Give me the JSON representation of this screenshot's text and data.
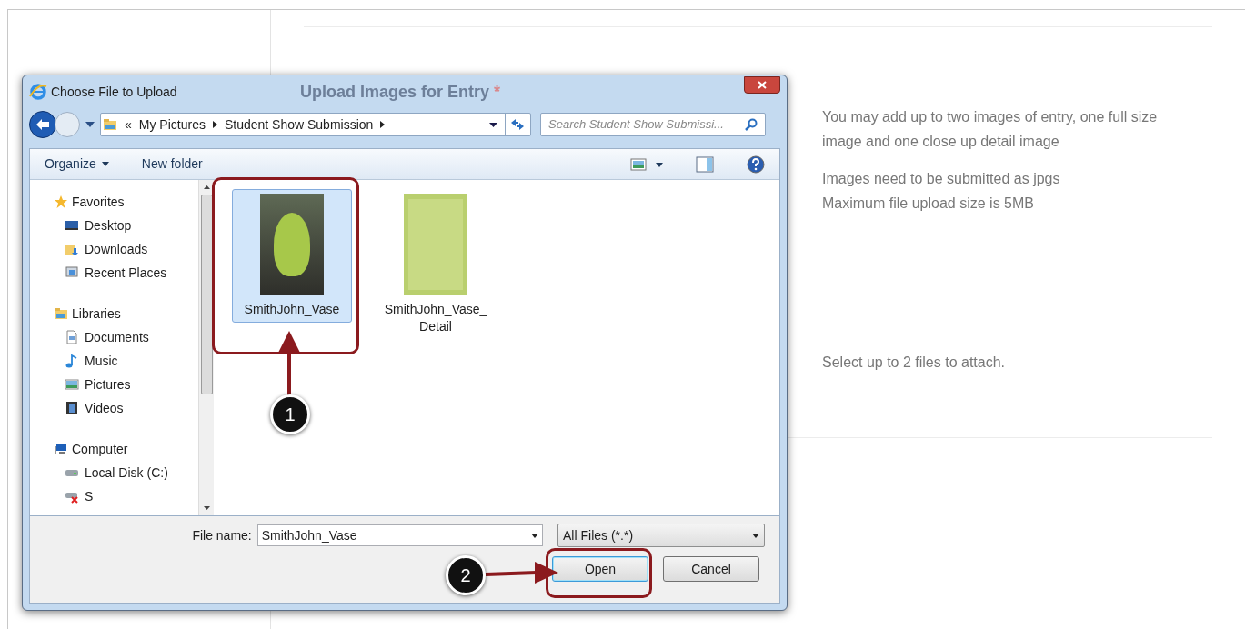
{
  "page": {
    "heading": "Upload Images for Entry",
    "required_mark": "*",
    "info": [
      "You may add up to two images of entry, one full size image and one close up detail image",
      "Images need to be submitted as jpgs",
      "Maximum file upload size is 5MB"
    ],
    "hint": "Select up to 2 files to attach."
  },
  "dialog": {
    "title": "Choose File to Upload",
    "breadcrumb_prefix": "«",
    "breadcrumb": [
      "My Pictures",
      "Student Show Submission"
    ],
    "search_placeholder": "Search Student Show Submissi...",
    "toolbar": [
      "Organize",
      "New folder"
    ],
    "nav": [
      {
        "label": "Favorites",
        "children": [
          {
            "label": "Desktop"
          },
          {
            "label": "Downloads"
          },
          {
            "label": "Recent Places"
          }
        ]
      },
      {
        "label": "Libraries",
        "children": [
          {
            "label": "Documents"
          },
          {
            "label": "Music"
          },
          {
            "label": "Pictures"
          },
          {
            "label": "Videos"
          }
        ]
      },
      {
        "label": "Computer",
        "children": [
          {
            "label": "Local Disk (C:)"
          },
          {
            "label": "S"
          }
        ]
      }
    ],
    "files": [
      {
        "name": "SmithJohn_Vase",
        "selected": true
      },
      {
        "name": "SmithJohn_Vase_ Detail",
        "selected": false
      }
    ],
    "file_name_label": "File name:",
    "file_name_value": "SmithJohn_Vase",
    "file_type": "All Files (*.*)",
    "buttons": [
      {
        "label": "Open",
        "default": true
      },
      {
        "label": "Cancel",
        "default": false
      }
    ]
  },
  "callouts": [
    "1",
    "2"
  ]
}
